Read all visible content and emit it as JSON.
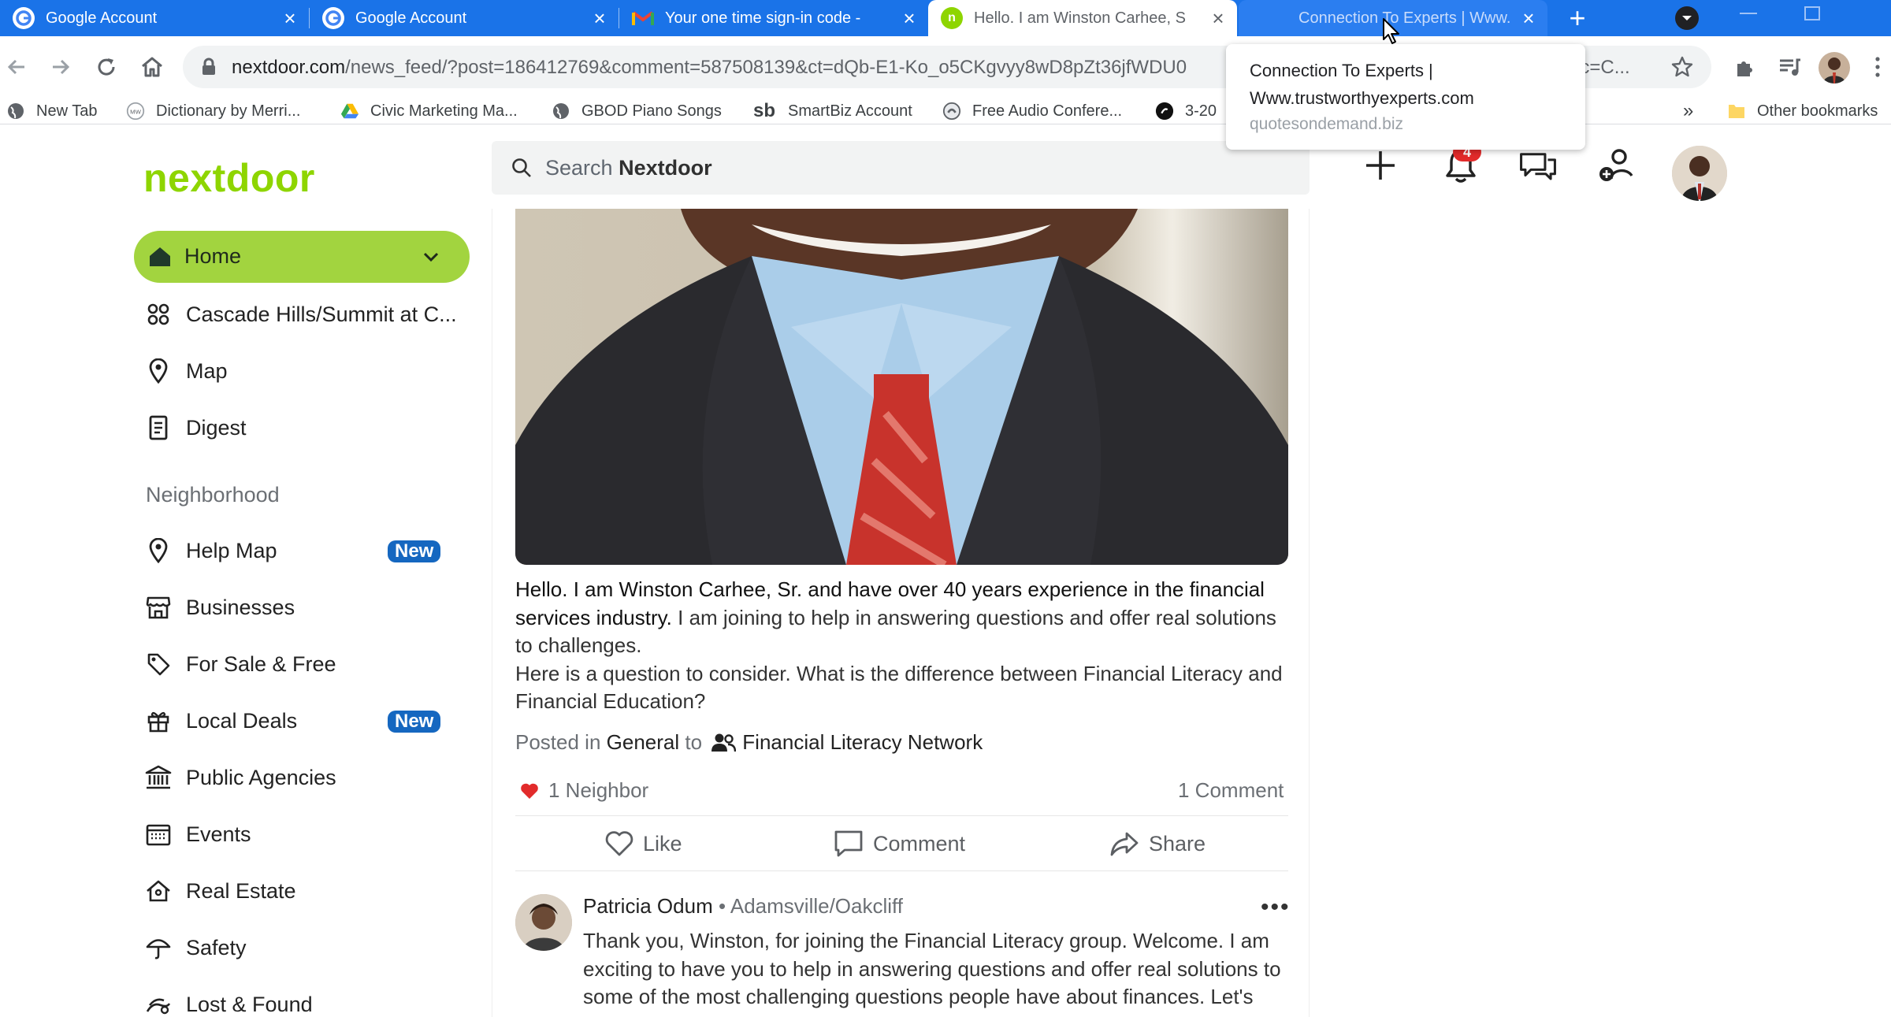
{
  "browser": {
    "tabs": [
      {
        "title": "Google Account",
        "icon": "google-g"
      },
      {
        "title": "Google Account",
        "icon": "google-g"
      },
      {
        "title": "Your one time sign-in code -",
        "icon": "gmail-m"
      },
      {
        "title": "Hello. I am Winston Carhee, S",
        "icon": "nextdoor-n",
        "active": true
      },
      {
        "title": "Connection To Experts | Www.",
        "icon": "none",
        "hovered": true
      }
    ],
    "new_tab_label": "+",
    "url": {
      "host": "nextdoor.com",
      "path": "/news_feed/?post=186412769&comment=587508139&ct=dQb-E1-Ko_o5CKgvyy8wD8pZt36jfWDU0",
      "tail": "ec=C..."
    },
    "bookmarks": [
      {
        "label": "New Tab",
        "icon": "globe-icon"
      },
      {
        "label": "Dictionary by Merri...",
        "icon": "mw-icon"
      },
      {
        "label": "Civic Marketing Ma...",
        "icon": "drive-icon"
      },
      {
        "label": "GBOD Piano Songs",
        "icon": "globe-icon"
      },
      {
        "label": "SmartBiz Account",
        "icon": "sb-icon"
      },
      {
        "label": "Free Audio Confere...",
        "icon": "phone-icon"
      },
      {
        "label": "3-20",
        "icon": "dark-circle-icon"
      }
    ],
    "bookmarks_overflow": "»",
    "other_bookmarks": "Other bookmarks",
    "tooltip": {
      "title_line1": "Connection To Experts |",
      "title_line2": "Www.trustworthyexperts.com",
      "domain": "quotesondemand.biz"
    }
  },
  "app": {
    "brand": "nextdoor",
    "brand_color": "#8ed500",
    "search": {
      "prefix": "Search",
      "brand": "Nextdoor"
    },
    "notification_count": "4",
    "sidebar": {
      "home": "Home",
      "items": [
        {
          "label": "Cascade Hills/Summit at C...",
          "icon": "neighborhood-icon"
        },
        {
          "label": "Map",
          "icon": "map-pin-icon"
        },
        {
          "label": "Digest",
          "icon": "digest-icon"
        }
      ],
      "neighborhood_heading": "Neighborhood",
      "neighborhood_items": [
        {
          "label": "Help Map",
          "icon": "map-pin-icon",
          "badge": "New"
        },
        {
          "label": "Businesses",
          "icon": "storefront-icon"
        },
        {
          "label": "For Sale & Free",
          "icon": "tag-icon"
        },
        {
          "label": "Local Deals",
          "icon": "gift-icon",
          "badge": "New"
        },
        {
          "label": "Public Agencies",
          "icon": "government-icon"
        },
        {
          "label": "Events",
          "icon": "calendar-icon"
        },
        {
          "label": "Real Estate",
          "icon": "house-icon"
        },
        {
          "label": "Safety",
          "icon": "umbrella-icon"
        },
        {
          "label": "Lost & Found",
          "icon": "paw-icon"
        }
      ]
    },
    "post": {
      "text_bold": "Hello. I am Winston Carhee, Sr. and have over 40 years experience in the financial services industry.",
      "text_rest": " I am joining to help in answering questions and offer real solutions to challenges.",
      "question": "Here is a question to consider.  What is the difference between Financial Literacy and Financial Education?",
      "posted_in_prefix": "Posted in",
      "category": "General",
      "to": "to",
      "group": "Financial Literacy Network",
      "reactions": "1 Neighbor",
      "comment_count": "1 Comment",
      "actions": {
        "like": "Like",
        "comment": "Comment",
        "share": "Share"
      }
    },
    "comment": {
      "author": "Patricia Odum",
      "separator": "•",
      "location": "Adamsville/Oakcliff",
      "more": "•••",
      "text": "Thank you, Winston, for joining the Financial Literacy group.  Welcome.  I am exciting to have you to help in answering questions and offer real solutions to some of the most  challenging questions people have about finances.  Let's"
    }
  }
}
